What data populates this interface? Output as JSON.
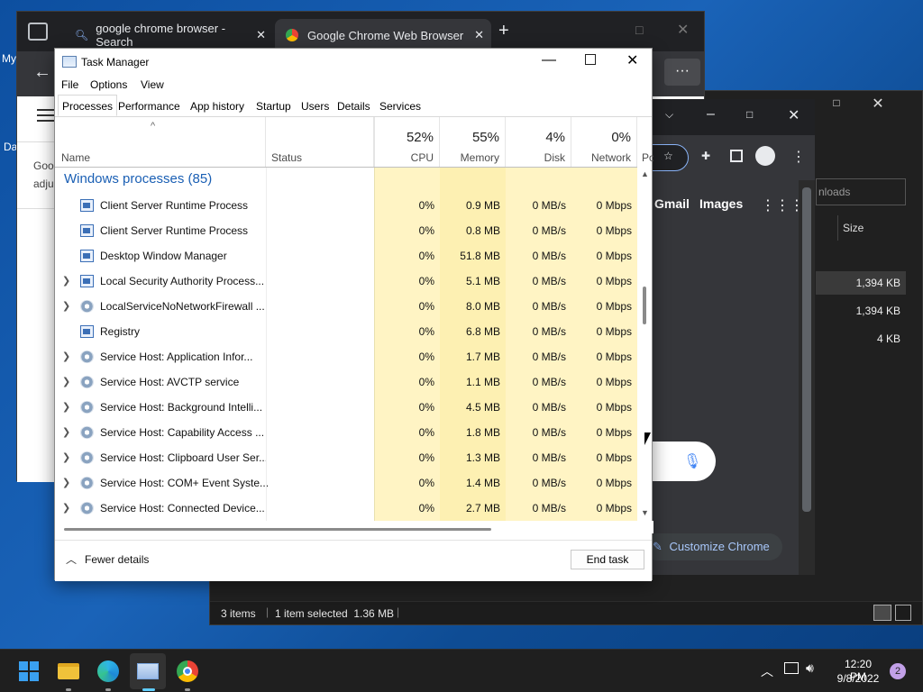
{
  "desktop": {
    "left_labels": [
      "My",
      "Da"
    ]
  },
  "chrome_back": {
    "tabs": [
      {
        "label": "google chrome browser - Search"
      },
      {
        "label": "Google Chrome Web Browser"
      }
    ],
    "page_snippet": [
      "Goo",
      "adju"
    ]
  },
  "chrome_front": {
    "links": [
      "Gmail",
      "Images"
    ],
    "customize_label": "Customize Chrome"
  },
  "explorer": {
    "search_placeholder": "nloads",
    "column_size": "Size",
    "sizes": [
      "1,394 KB",
      "1,394 KB",
      "4 KB"
    ],
    "status_items": "3 items",
    "status_selected": "1 item selected  1.36 MB"
  },
  "task_manager": {
    "title": "Task Manager",
    "menu": [
      "File",
      "Options",
      "View"
    ],
    "tabs": [
      "Processes",
      "Performance",
      "App history",
      "Startup",
      "Users",
      "Details",
      "Services"
    ],
    "columns": {
      "name": "Name",
      "status": "Status",
      "cpu": {
        "pct": "52%",
        "label": "CPU"
      },
      "memory": {
        "pct": "55%",
        "label": "Memory"
      },
      "disk": {
        "pct": "4%",
        "label": "Disk"
      },
      "network": {
        "pct": "0%",
        "label": "Network"
      },
      "power": "Po"
    },
    "group": "Windows processes (85)",
    "processes": [
      {
        "name": "Client Server Runtime Process",
        "cpu": "0%",
        "mem": "0.9 MB",
        "disk": "0 MB/s",
        "net": "0 Mbps",
        "icon": "process-icon",
        "expand": false
      },
      {
        "name": "Client Server Runtime Process",
        "cpu": "0%",
        "mem": "0.8 MB",
        "disk": "0 MB/s",
        "net": "0 Mbps",
        "icon": "process-icon",
        "expand": false
      },
      {
        "name": "Desktop Window Manager",
        "cpu": "0%",
        "mem": "51.8 MB",
        "disk": "0 MB/s",
        "net": "0 Mbps",
        "icon": "process-icon",
        "expand": false
      },
      {
        "name": "Local Security Authority Process...",
        "cpu": "0%",
        "mem": "5.1 MB",
        "disk": "0 MB/s",
        "net": "0 Mbps",
        "icon": "process-icon",
        "expand": true
      },
      {
        "name": "LocalServiceNoNetworkFirewall ...",
        "cpu": "0%",
        "mem": "8.0 MB",
        "disk": "0 MB/s",
        "net": "0 Mbps",
        "icon": "gear-icon",
        "expand": true
      },
      {
        "name": "Registry",
        "cpu": "0%",
        "mem": "6.8 MB",
        "disk": "0 MB/s",
        "net": "0 Mbps",
        "icon": "process-icon",
        "expand": false
      },
      {
        "name": "Service Host: Application Infor...",
        "cpu": "0%",
        "mem": "1.7 MB",
        "disk": "0 MB/s",
        "net": "0 Mbps",
        "icon": "gear-icon",
        "expand": true
      },
      {
        "name": "Service Host: AVCTP service",
        "cpu": "0%",
        "mem": "1.1 MB",
        "disk": "0 MB/s",
        "net": "0 Mbps",
        "icon": "gear-icon",
        "expand": true
      },
      {
        "name": "Service Host: Background Intelli...",
        "cpu": "0%",
        "mem": "4.5 MB",
        "disk": "0 MB/s",
        "net": "0 Mbps",
        "icon": "gear-icon",
        "expand": true
      },
      {
        "name": "Service Host: Capability Access ...",
        "cpu": "0%",
        "mem": "1.8 MB",
        "disk": "0 MB/s",
        "net": "0 Mbps",
        "icon": "gear-icon",
        "expand": true
      },
      {
        "name": "Service Host: Clipboard User Ser...",
        "cpu": "0%",
        "mem": "1.3 MB",
        "disk": "0 MB/s",
        "net": "0 Mbps",
        "icon": "gear-icon",
        "expand": true
      },
      {
        "name": "Service Host: COM+ Event Syste...",
        "cpu": "0%",
        "mem": "1.4 MB",
        "disk": "0 MB/s",
        "net": "0 Mbps",
        "icon": "gear-icon",
        "expand": true
      },
      {
        "name": "Service Host: Connected Device...",
        "cpu": "0%",
        "mem": "2.7 MB",
        "disk": "0 MB/s",
        "net": "0 Mbps",
        "icon": "gear-icon",
        "expand": true
      }
    ],
    "fewer_details": "Fewer details",
    "end_task": "End task"
  },
  "taskbar": {
    "time": "12:20 PM",
    "date": "9/8/2022",
    "notification_count": "2"
  },
  "colors": {
    "accent": "#1a5fb4",
    "heat_cell": "#fff4c4"
  }
}
